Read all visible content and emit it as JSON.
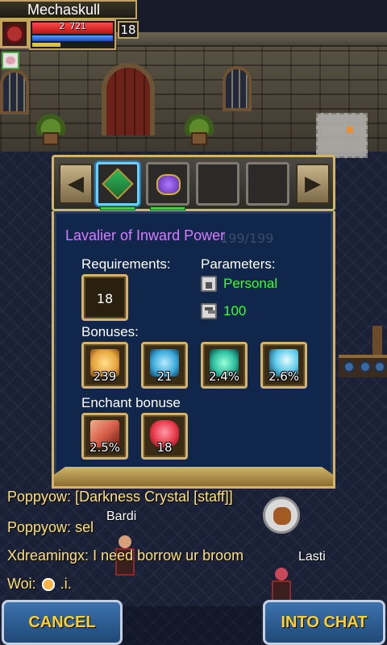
{
  "player": {
    "name": "Mechaskull",
    "hp_text": "2 721",
    "level": "18",
    "hp_fraction": 1.0,
    "mp_fraction": 1.0,
    "xp_fraction": 0.35
  },
  "slots": {
    "prev_glyph": "◀",
    "next_glyph": "▶",
    "items": [
      {
        "icon": "green-amulet-icon",
        "active": true
      },
      {
        "icon": "purple-gem-amulet-icon",
        "active": false
      },
      {
        "icon": "",
        "active": false
      },
      {
        "icon": "",
        "active": false
      }
    ]
  },
  "item": {
    "title": "Lavalier of Inward Power",
    "ghost_count": "199/199",
    "requirements_label": "Requirements:",
    "required_level": "18",
    "parameters_label": "Parameters:",
    "binding": "Personal",
    "durability": "100",
    "bonuses_label": "Bonuses:",
    "bonuses": [
      {
        "icon": "strength-icon",
        "value": "239",
        "color": "#e8a540"
      },
      {
        "icon": "intellect-icon",
        "value": "21",
        "color": "#3aa8d8"
      },
      {
        "icon": "dodge-icon",
        "value": "2.4%",
        "color": "#2fc0a0"
      },
      {
        "icon": "crit-icon",
        "value": "2.6%",
        "color": "#58c8e8"
      }
    ],
    "enchant_label": "Enchant bonuse",
    "enchant_bonuses": [
      {
        "icon": "sword-damage-icon",
        "value": "2.5%",
        "color": "#d8604a"
      },
      {
        "icon": "heart-health-icon",
        "value": "18",
        "color": "#e83a4a"
      }
    ]
  },
  "chat": {
    "lines": [
      {
        "who": "Poppyow:",
        "text": " [Darkness Crystal [staff]]"
      },
      {
        "who": "Poppyow:",
        "text": " sel"
      },
      {
        "who": "Xdreamingx:",
        "text": " I need borrow ur broom"
      },
      {
        "who": "Woi:",
        "text": " .i."
      }
    ],
    "name_tags": [
      "Bardi",
      "Lasti"
    ]
  },
  "buttons": {
    "cancel": "CANCEL",
    "into_chat": "INTO CHAT"
  }
}
